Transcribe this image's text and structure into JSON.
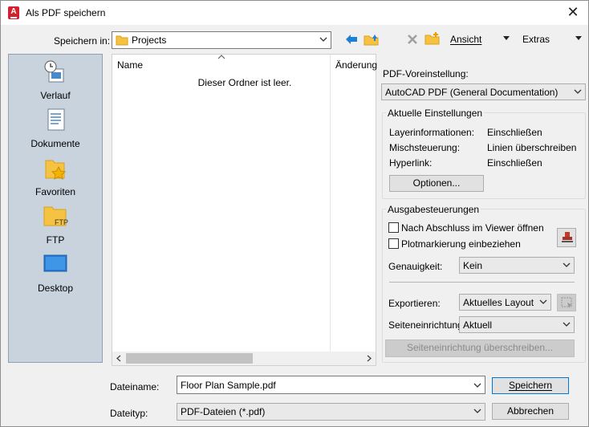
{
  "window": {
    "title": "Als PDF speichern",
    "app_icon_letter": "A"
  },
  "toolbar": {
    "save_in_label": "Speichern in:",
    "save_in_value": "Projects",
    "view_label": "Ansicht",
    "extras_label": "Extras"
  },
  "places": [
    {
      "label": "Verlauf",
      "icon": "history-icon"
    },
    {
      "label": "Dokumente",
      "icon": "documents-icon"
    },
    {
      "label": "Favoriten",
      "icon": "favorites-icon"
    },
    {
      "label": "FTP",
      "icon": "ftp-folder-icon",
      "icon_text": "FTP"
    },
    {
      "label": "Desktop",
      "icon": "desktop-icon"
    }
  ],
  "filelist": {
    "col_name": "Name",
    "col_date": "Änderungsdatum",
    "empty_text": "Dieser Ordner ist leer."
  },
  "pdf": {
    "preset_label": "PDF-Voreinstellung:",
    "preset_value": "AutoCAD PDF (General Documentation)",
    "current_settings_title": "Aktuelle Einstellungen",
    "settings": [
      {
        "key": "Layerinformationen:",
        "value": "Einschließen"
      },
      {
        "key": "Mischsteuerung:",
        "value": "Linien überschreiben"
      },
      {
        "key": "Hyperlink:",
        "value": "Einschließen"
      }
    ],
    "options_button": "Optionen..."
  },
  "output": {
    "title": "Ausgabesteuerungen",
    "open_viewer_label": "Nach Abschluss im Viewer öffnen",
    "open_viewer_checked": false,
    "plot_stamp_label": "Plotmarkierung einbeziehen",
    "plot_stamp_checked": false,
    "precision_label": "Genauigkeit:",
    "precision_value": "Kein",
    "export_label": "Exportieren:",
    "export_value": "Aktuelles Layout",
    "page_setup_label": "Seiteneinrichtung:",
    "page_setup_value": "Aktuell",
    "override_button": "Seiteneinrichtung überschreiben..."
  },
  "footer": {
    "filename_label": "Dateiname:",
    "filename_value": "Floor Plan Sample.pdf",
    "filetype_label": "Dateityp:",
    "filetype_value": "PDF-Dateien (*.pdf)",
    "save_button": "Speichern",
    "cancel_button": "Abbrechen"
  },
  "colors": {
    "places_bg": "#c8d3de",
    "accent_blue": "#1e7fd6",
    "folder_yellow": "#f5c242",
    "app_red": "#d3202e"
  }
}
